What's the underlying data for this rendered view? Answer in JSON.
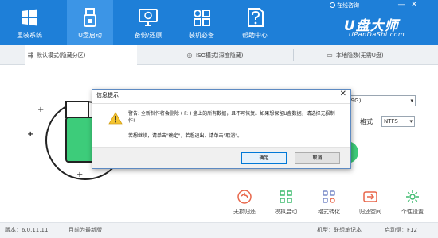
{
  "header": {
    "nav": [
      {
        "label": "重装系统",
        "icon": "windows-logo-icon"
      },
      {
        "label": "U盘启动",
        "icon": "usb-drive-icon"
      },
      {
        "label": "备份/还原",
        "icon": "backup-restore-icon"
      },
      {
        "label": "装机必备",
        "icon": "apps-grid-icon"
      },
      {
        "label": "帮助中心",
        "icon": "help-question-icon"
      }
    ],
    "active_nav": "U盘启动",
    "online_support": "在线咨询",
    "window_controls": {
      "minimize": "—",
      "close": "✕"
    },
    "logo": {
      "main": "U盘大师",
      "sub": "UPanDaShi.com"
    },
    "accent_color": "#1e7fd8"
  },
  "modes": [
    {
      "label": "默认模式(隐藏分区)",
      "icon": "usb-symbol-icon"
    },
    {
      "label": "ISO模式(深度隐藏)",
      "icon": "disc-icon"
    },
    {
      "label": "本地隐数(无需U盘)",
      "icon": "computer-icon"
    }
  ],
  "main": {
    "device_select": "(9G)",
    "format_label": "格式",
    "format_value": "NTFS"
  },
  "tools": [
    {
      "label": "无损归还",
      "icon": "undo-icon"
    },
    {
      "label": "模拟启动",
      "icon": "simulate-boot-icon"
    },
    {
      "label": "格式转化",
      "icon": "format-convert-icon"
    },
    {
      "label": "归还空间",
      "icon": "return-space-icon"
    },
    {
      "label": "个性设置",
      "icon": "settings-icon"
    }
  ],
  "status": {
    "version": "版本：6.0.11.11",
    "update": "目前为最新版",
    "model": "机型：联想笔记本",
    "hotkey": "启动键：F12"
  },
  "dialog": {
    "title": "信息提示",
    "close": "✕",
    "message1": "警告: 全新制作将会删除 ( F: ) 盘上的所有数据，且不可恢复。如果想保留U盘数据，请选择无损制作!",
    "message2": "若想继续，请单击\"确定\"，若想退出，请单击\"取消\"。",
    "ok": "确定",
    "cancel": "取消",
    "warn_color": "#f4c430"
  }
}
